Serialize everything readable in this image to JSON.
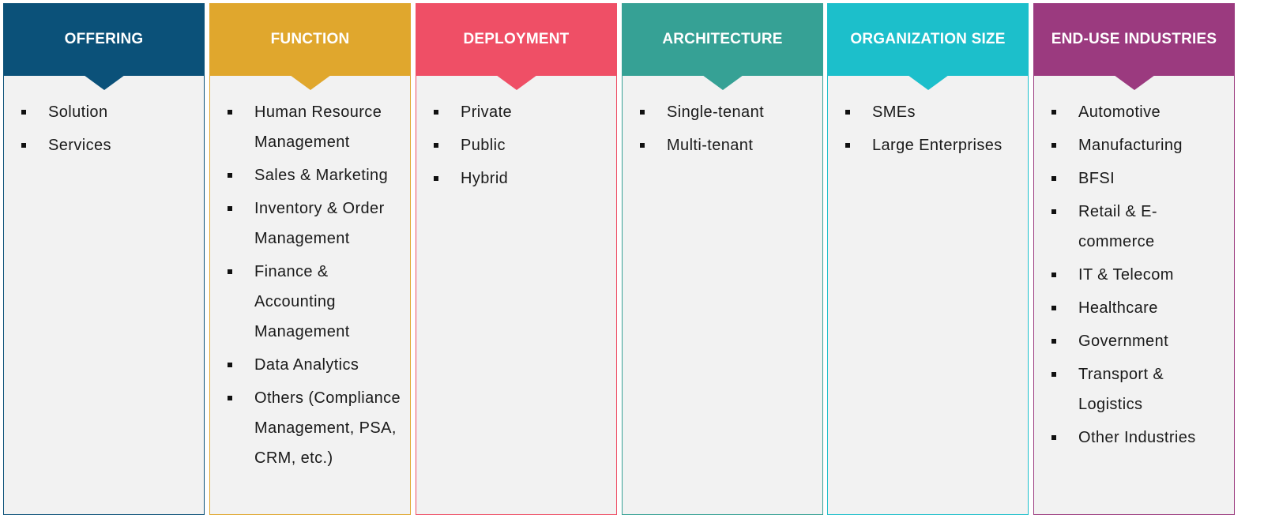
{
  "columns": [
    {
      "title": "OFFERING",
      "color": "#0b5179",
      "items": [
        "Solution",
        "Services"
      ]
    },
    {
      "title": "FUNCTION",
      "color": "#e0a72d",
      "items": [
        "Human Resource Management",
        "Sales & Marketing",
        "Inventory & Order Management",
        "Finance & Accounting Management",
        "Data Analytics",
        "Others (Compliance Management, PSA, CRM, etc.)"
      ]
    },
    {
      "title": "DEPLOYMENT",
      "color": "#ef4f66",
      "items": [
        "Private",
        "Public",
        "Hybrid"
      ]
    },
    {
      "title": "ARCHITECTURE",
      "color": "#36a195",
      "items": [
        "Single-tenant",
        "Multi-tenant"
      ]
    },
    {
      "title": "ORGANIZATION SIZE",
      "color": "#1cbfcb",
      "items": [
        "SMEs",
        "Large Enterprises"
      ]
    },
    {
      "title": "END-USE INDUSTRIES",
      "color": "#9b3a7f",
      "items": [
        "Automotive",
        "Manufacturing",
        "BFSI",
        "Retail & E-commerce",
        "IT & Telecom",
        "Healthcare",
        "Government",
        "Transport & Logistics",
        "Other Industries"
      ]
    }
  ]
}
